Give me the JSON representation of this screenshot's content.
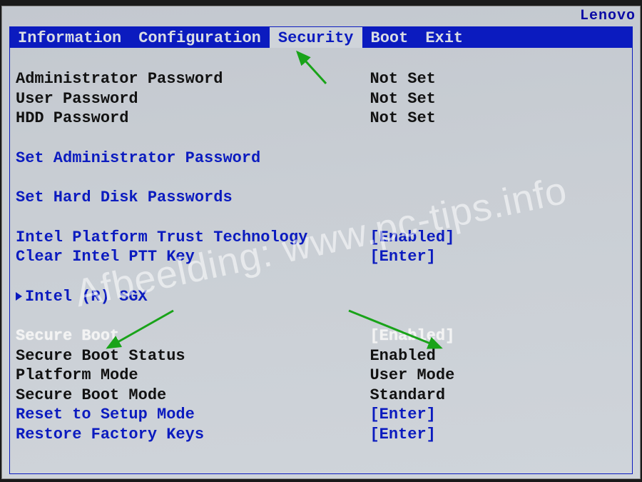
{
  "brand": "Lenovo",
  "tabs": [
    {
      "label": "Information",
      "active": false
    },
    {
      "label": "Configuration",
      "active": false
    },
    {
      "label": "Security",
      "active": true
    },
    {
      "label": "Boot",
      "active": false
    },
    {
      "label": "Exit",
      "active": false
    }
  ],
  "rows": {
    "admin_pw": {
      "label": "Administrator Password",
      "value": "Not Set"
    },
    "user_pw": {
      "label": "User Password",
      "value": "Not Set"
    },
    "hdd_pw": {
      "label": "HDD Password",
      "value": "Not Set"
    },
    "set_admin_pw": {
      "label": "Set Administrator Password"
    },
    "set_hdd_pw": {
      "label": "Set Hard Disk Passwords"
    },
    "ptt": {
      "label": "Intel Platform Trust Technology",
      "value": "[Enabled]"
    },
    "clear_ptt": {
      "label": "Clear Intel PTT Key",
      "value": "[Enter]"
    },
    "sgx": {
      "label": "Intel (R) SGX"
    },
    "secure_boot": {
      "label": "Secure Boot",
      "value": "[Enabled]"
    },
    "sb_status": {
      "label": "Secure Boot Status",
      "value": "Enabled"
    },
    "platform_mode": {
      "label": "Platform Mode",
      "value": "User Mode"
    },
    "sb_mode": {
      "label": "Secure Boot Mode",
      "value": "Standard"
    },
    "reset_setup": {
      "label": "Reset to Setup Mode",
      "value": "[Enter]"
    },
    "restore_keys": {
      "label": "Restore Factory Keys",
      "value": "[Enter]"
    }
  },
  "watermark": "Afbeelding: www.pc-tips.info",
  "annotation_color": "#19a319"
}
